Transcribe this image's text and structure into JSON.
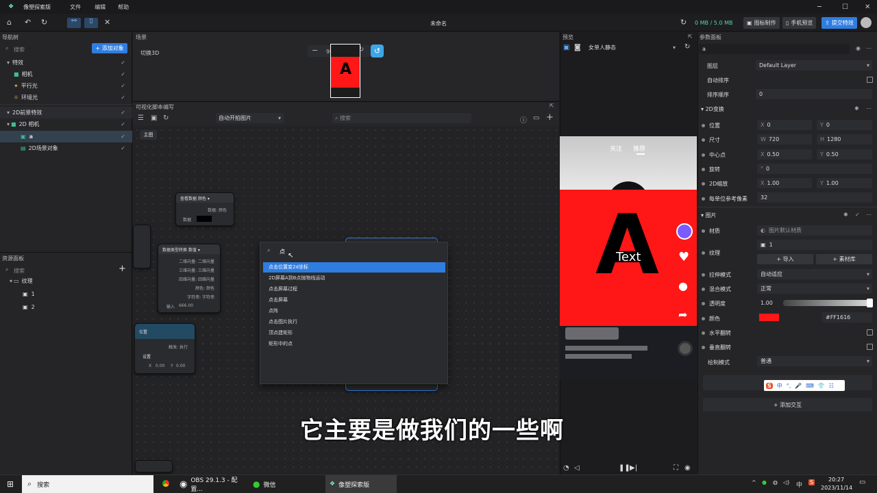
{
  "app": {
    "name": "像塑探索版",
    "menus": [
      "文件",
      "编辑",
      "帮助"
    ],
    "doc_title": "未命名",
    "memory": "0 MB / 5.0 MB",
    "actions": [
      {
        "label": "图标制作"
      },
      {
        "label": "手机预览"
      },
      {
        "label": "提交特效"
      }
    ]
  },
  "nav": {
    "title": "导航树",
    "search_placeholder": "搜索",
    "add_label": "+ 添加对象",
    "items": [
      {
        "label": "特效",
        "icon": "chevron-down-icon"
      },
      {
        "label": "相机"
      },
      {
        "label": "平行光"
      },
      {
        "label": "环境光"
      },
      {
        "label": "2D前景特效"
      },
      {
        "label": "2D 相机"
      },
      {
        "label": "a"
      },
      {
        "label": "2D场景对象"
      }
    ]
  },
  "assets": {
    "title": "资源面板",
    "search_placeholder": "搜索",
    "folder": "纹理",
    "items": [
      "1",
      "2"
    ]
  },
  "scene": {
    "title": "场景",
    "toggle_label": "切换3D",
    "zoom": "90%",
    "thumb_letter": "A"
  },
  "script": {
    "title": "可视化脚本编写",
    "dropdown": "自动开拍图片",
    "search_placeholder": "搜索",
    "tab": "主图",
    "search_value": "点",
    "results": [
      "点击位置变2d坐标",
      "2D屏幕A到B点抛物线运动",
      "点击屏幕过程",
      "点击屏幕",
      "点阵",
      "点击图片执行",
      "顶点建矩形",
      "矩形中的点"
    ],
    "nodes": {
      "n1": {
        "title": "查看数据 颜色 ▾",
        "r1": "数据: 颜色",
        "r2": "数据"
      },
      "n2": {
        "title": "数据类型转换 数值 ▾",
        "rows": [
          "二维向量: 二维向量",
          "三维向量: 三维向量",
          "四维向量: 四维向量",
          "颜色: 颜色",
          "字符串: 字符串"
        ],
        "input_label": "输入",
        "input_value": "666.00"
      },
      "n3": {
        "title": "位置",
        "r1": "触发: 执行",
        "r2": "设置",
        "x_label": "X",
        "x_value": "0.00",
        "y_label": "Y",
        "y_value": "0.00"
      }
    }
  },
  "preview": {
    "title": "预览",
    "dropdown": "女单人静态",
    "tab1": "关注",
    "tab2": "推荐",
    "letter": "A",
    "overlay_text": "Text"
  },
  "props": {
    "title": "参数面板",
    "name": "a",
    "layer_label": "图层",
    "layer_value": "Default Layer",
    "auto_sort": "自动排序",
    "sort_order_label": "排序顺序",
    "sort_order_value": "0",
    "t2d": "2D变换",
    "pos_label": "位置",
    "pos_x": "0",
    "pos_y": "0",
    "size_label": "尺寸",
    "size_w": "720",
    "size_h": "1280",
    "pivot_label": "中心点",
    "pivot_x": "0.50",
    "pivot_y": "0.50",
    "rot_label": "旋转",
    "rot_v": "0",
    "scale_label": "2D缩放",
    "scale_x": "1.00",
    "scale_y": "1.00",
    "ppu_label": "每单位参考像素",
    "ppu_v": "32",
    "img": "图片",
    "mat_label": "材质",
    "mat_v": "图片默认材质",
    "tex_label": "纹理",
    "tex_v": "1",
    "import_label": "+ 导入",
    "lib_label": "+ 素材库",
    "stretch_label": "拉伸模式",
    "stretch_v": "自动适应",
    "blend_label": "混合模式",
    "blend_v": "正常",
    "opacity_label": "透明度",
    "opacity_v": "1.00",
    "color_label": "颜色",
    "color_v": "#FF1616",
    "flipx_label": "水平翻转",
    "flipy_label": "垂直翻转",
    "draw_label": "绘制模式",
    "draw_v": "普通",
    "add_interact": "+ 添加交互",
    "xlbl": "X",
    "ylbl": "Y",
    "wlbl": "W",
    "hlbl": "H"
  },
  "ime": {
    "chars": [
      "中",
      "°,",
      "🎤",
      "⌨",
      "👕",
      "☷"
    ]
  },
  "subtitle": "它主要是做我们的一些啊",
  "taskbar": {
    "search": "搜索",
    "items": [
      "OBS 29.1.3 - 配置...",
      "微信",
      "像塑探索版"
    ],
    "time": "20:27",
    "date": "2023/11/14",
    "lang": "中"
  },
  "colors": {
    "accent": "#2f7de1",
    "red": "#FF1616"
  }
}
